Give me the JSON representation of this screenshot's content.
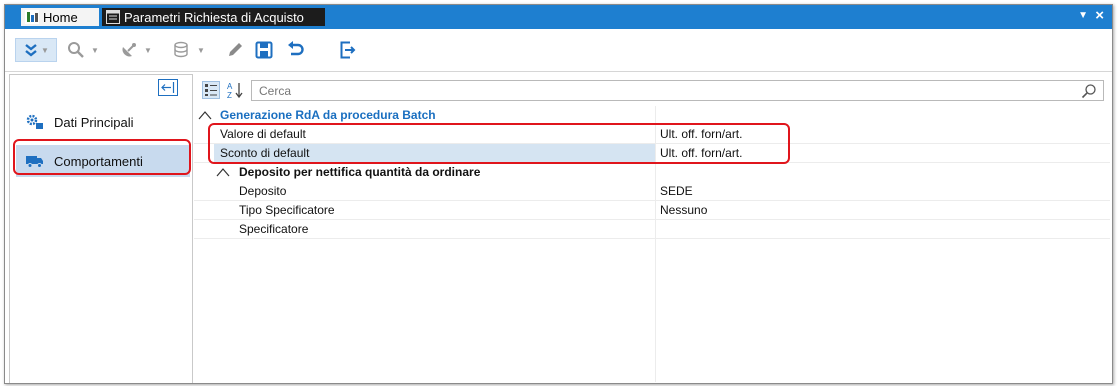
{
  "tabs": {
    "home": "Home",
    "active": "Parametri Richiesta di Acquisto"
  },
  "toolbar": {
    "icons": [
      "double-chevron-down-icon",
      "search-icon",
      "satellite-icon",
      "database-icon",
      "edit-icon",
      "save-icon",
      "undo-icon",
      "exit-icon"
    ]
  },
  "sidebar": {
    "items": [
      {
        "label": "Dati Principali",
        "icon": "gears-icon",
        "selected": false
      },
      {
        "label": "Comportamenti",
        "icon": "truck-icon",
        "selected": true
      }
    ]
  },
  "search": {
    "placeholder": "Cerca",
    "value": ""
  },
  "properties": {
    "category": "Generazione RdA da procedura Batch",
    "rows": [
      {
        "name": "Valore di default",
        "value": "Ult. off. forn/art."
      },
      {
        "name": "Sconto di default",
        "value": "Ult. off. forn/art."
      }
    ],
    "subcategory": "Deposito per nettifica quantità da ordinare",
    "subrows": [
      {
        "name": "Deposito",
        "value": "SEDE"
      },
      {
        "name": "Tipo Specificatore",
        "value": "Nessuno"
      },
      {
        "name": "Specificatore",
        "value": ""
      }
    ]
  },
  "colors": {
    "tabbar": "#1e7fd0",
    "accent": "#1a6fc0",
    "highlight_box": "#e0151c",
    "selection": "#c8daee"
  }
}
